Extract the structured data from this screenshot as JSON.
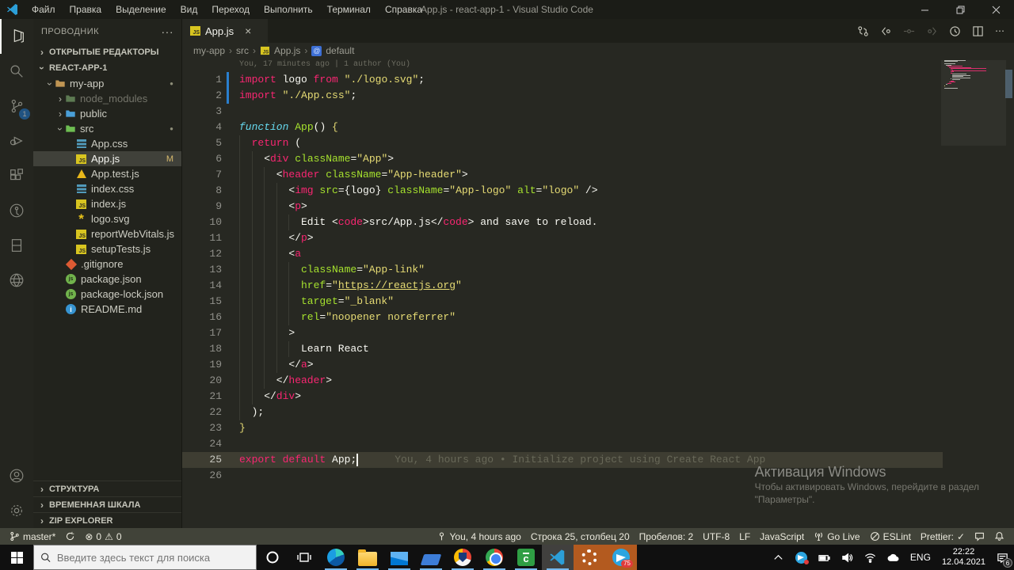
{
  "window": {
    "title": "App.js - react-app-1 - Visual Studio Code"
  },
  "menu": [
    "Файл",
    "Правка",
    "Выделение",
    "Вид",
    "Переход",
    "Выполнить",
    "Терминал",
    "Справка"
  ],
  "glyphs": {
    "dots": "···",
    "more": "⋯",
    "chev": "›",
    "close": "×",
    "err": "⊗",
    "warn": "⚠",
    "check": "✓",
    "star": "*",
    "info_i": "i",
    "js": "JS",
    "npm_js": "js",
    "green_app": "c"
  },
  "activity_badge": "1",
  "sidebar": {
    "title": "ПРОВОДНИК",
    "open_editors": "ОТКРЫТЫЕ РЕДАКТОРЫ",
    "project": "REACT-APP-1",
    "outline": "СТРУКТУРА",
    "timeline": "ВРЕМЕННАЯ ШКАЛА",
    "zip": "ZIP EXPLORER",
    "tree": [
      {
        "label": "my-app",
        "icon": "folder",
        "color": "#c09553",
        "indent": 0,
        "chev": "open",
        "badge": "dot"
      },
      {
        "label": "node_modules",
        "icon": "folder",
        "color": "#5d7a52",
        "indent": 1,
        "chev": "closed",
        "dim": true
      },
      {
        "label": "public",
        "icon": "folder",
        "color": "#4a9fd8",
        "indent": 1,
        "chev": "closed"
      },
      {
        "label": "src",
        "icon": "folder",
        "color": "#6ebe52",
        "indent": 1,
        "chev": "open",
        "badge": "dot"
      },
      {
        "label": "App.css",
        "icon": "css",
        "indent": 2
      },
      {
        "label": "App.js",
        "icon": "js",
        "indent": 2,
        "selected": true,
        "badge": "M"
      },
      {
        "label": "App.test.js",
        "icon": "test",
        "indent": 2
      },
      {
        "label": "index.css",
        "icon": "css",
        "indent": 2
      },
      {
        "label": "index.js",
        "icon": "js",
        "indent": 2
      },
      {
        "label": "logo.svg",
        "icon": "svg",
        "indent": 2
      },
      {
        "label": "reportWebVitals.js",
        "icon": "js",
        "indent": 2
      },
      {
        "label": "setupTests.js",
        "icon": "js",
        "indent": 2
      },
      {
        "label": ".gitignore",
        "icon": "git",
        "indent": 1
      },
      {
        "label": "package.json",
        "icon": "npm",
        "indent": 1
      },
      {
        "label": "package-lock.json",
        "icon": "npm",
        "indent": 1
      },
      {
        "label": "README.md",
        "icon": "info",
        "indent": 1
      }
    ]
  },
  "editor": {
    "tab": "App.js",
    "breadcrumbs": [
      "my-app",
      "src",
      "App.js",
      "default"
    ],
    "codelens": "You, 17 minutes ago | 1 author (You)",
    "blame": "You, 4 hours ago • Initialize project using Create React App",
    "lines": [
      {
        "ind": 0,
        "git": true,
        "tk": [
          [
            "k",
            "import"
          ],
          [
            "w",
            " logo "
          ],
          [
            "k",
            "from"
          ],
          [
            "w",
            " "
          ],
          [
            "s",
            "\"./logo.svg\""
          ],
          [
            "w",
            ";"
          ]
        ]
      },
      {
        "ind": 0,
        "git": true,
        "tk": [
          [
            "k",
            "import"
          ],
          [
            "w",
            " "
          ],
          [
            "s",
            "\"./App.css\""
          ],
          [
            "w",
            ";"
          ]
        ]
      },
      {
        "ind": 0,
        "tk": []
      },
      {
        "ind": 0,
        "tk": [
          [
            "c",
            "function"
          ],
          [
            "w",
            " "
          ],
          [
            "f",
            "App"
          ],
          [
            "w",
            "() "
          ],
          [
            "y",
            "{"
          ]
        ]
      },
      {
        "ind": 1,
        "tk": [
          [
            "k",
            "return"
          ],
          [
            "w",
            " ("
          ]
        ]
      },
      {
        "ind": 2,
        "tk": [
          [
            "w",
            "<"
          ],
          [
            "k",
            "div"
          ],
          [
            "w",
            " "
          ],
          [
            "f",
            "className"
          ],
          [
            "w",
            "="
          ],
          [
            "s",
            "\"App\""
          ],
          [
            "w",
            ">"
          ]
        ]
      },
      {
        "ind": 3,
        "tk": [
          [
            "w",
            "<"
          ],
          [
            "k",
            "header"
          ],
          [
            "w",
            " "
          ],
          [
            "f",
            "className"
          ],
          [
            "w",
            "="
          ],
          [
            "s",
            "\"App-header\""
          ],
          [
            "w",
            ">"
          ]
        ]
      },
      {
        "ind": 4,
        "tk": [
          [
            "w",
            "<"
          ],
          [
            "k",
            "img"
          ],
          [
            "w",
            " "
          ],
          [
            "f",
            "src"
          ],
          [
            "w",
            "={logo} "
          ],
          [
            "f",
            "className"
          ],
          [
            "w",
            "="
          ],
          [
            "s",
            "\"App-logo\""
          ],
          [
            "w",
            " "
          ],
          [
            "f",
            "alt"
          ],
          [
            "w",
            "="
          ],
          [
            "s",
            "\"logo\""
          ],
          [
            "w",
            " />"
          ]
        ]
      },
      {
        "ind": 4,
        "tk": [
          [
            "w",
            "<"
          ],
          [
            "k",
            "p"
          ],
          [
            "w",
            ">"
          ]
        ]
      },
      {
        "ind": 5,
        "tk": [
          [
            "w",
            "Edit <"
          ],
          [
            "k",
            "code"
          ],
          [
            "w",
            ">src/App.js</"
          ],
          [
            "k",
            "code"
          ],
          [
            "w",
            "> and save to reload."
          ]
        ]
      },
      {
        "ind": 4,
        "tk": [
          [
            "w",
            "</"
          ],
          [
            "k",
            "p"
          ],
          [
            "w",
            ">"
          ]
        ]
      },
      {
        "ind": 4,
        "tk": [
          [
            "w",
            "<"
          ],
          [
            "k",
            "a"
          ]
        ]
      },
      {
        "ind": 5,
        "tk": [
          [
            "f",
            "className"
          ],
          [
            "w",
            "="
          ],
          [
            "s",
            "\"App-link\""
          ]
        ]
      },
      {
        "ind": 5,
        "tk": [
          [
            "f",
            "href"
          ],
          [
            "w",
            "="
          ],
          [
            "s",
            "\""
          ],
          [
            "u",
            "https://reactjs.org"
          ],
          [
            "s",
            "\""
          ]
        ]
      },
      {
        "ind": 5,
        "tk": [
          [
            "f",
            "target"
          ],
          [
            "w",
            "="
          ],
          [
            "s",
            "\"_blank\""
          ]
        ]
      },
      {
        "ind": 5,
        "tk": [
          [
            "f",
            "rel"
          ],
          [
            "w",
            "="
          ],
          [
            "s",
            "\"noopener noreferrer\""
          ]
        ]
      },
      {
        "ind": 4,
        "tk": [
          [
            "w",
            ">"
          ]
        ]
      },
      {
        "ind": 5,
        "tk": [
          [
            "w",
            "Learn React"
          ]
        ]
      },
      {
        "ind": 4,
        "tk": [
          [
            "w",
            "</"
          ],
          [
            "k",
            "a"
          ],
          [
            "w",
            ">"
          ]
        ]
      },
      {
        "ind": 3,
        "tk": [
          [
            "w",
            "</"
          ],
          [
            "k",
            "header"
          ],
          [
            "w",
            ">"
          ]
        ]
      },
      {
        "ind": 2,
        "tk": [
          [
            "w",
            "</"
          ],
          [
            "k",
            "div"
          ],
          [
            "w",
            ">"
          ]
        ]
      },
      {
        "ind": 1,
        "tk": [
          [
            "w",
            ");"
          ]
        ]
      },
      {
        "ind": 0,
        "tk": [
          [
            "y",
            "}"
          ]
        ]
      },
      {
        "ind": 0,
        "tk": []
      },
      {
        "ind": 0,
        "cur": true,
        "tk": [
          [
            "k",
            "export"
          ],
          [
            "w",
            " "
          ],
          [
            "k",
            "default"
          ],
          [
            "w",
            " App;"
          ]
        ]
      },
      {
        "ind": 0,
        "tk": []
      }
    ]
  },
  "watermark": {
    "title": "Активация Windows",
    "line1": "Чтобы активировать Windows, перейдите в раздел",
    "line2": "\"Параметры\"."
  },
  "status_bar": {
    "branch": "master*",
    "errors": "0",
    "warnings": "0",
    "blame": "You, 4 hours ago",
    "cursor": "Строка 25, столбец 20",
    "spaces": "Пробелов: 2",
    "encoding": "UTF-8",
    "eol": "LF",
    "language": "JavaScript",
    "golive": "Go Live",
    "eslint": "ESLint",
    "prettier": "Prettier:"
  },
  "taskbar": {
    "search_placeholder": "Введите здесь текст для поиска",
    "telegram_badge": "75",
    "tray": {
      "lang": "ENG",
      "time": "22:22",
      "date": "12.04.2021",
      "notifications": "6"
    }
  },
  "colors": {
    "keyword": "#f92672",
    "string": "#e6db74",
    "attr": "#a6e22e",
    "func_kw": "#66d9ef",
    "fg": "#f8f8f2",
    "statusbar": "#414339",
    "editor_bg": "#272822",
    "badge_blue": "#1e7ad3"
  }
}
